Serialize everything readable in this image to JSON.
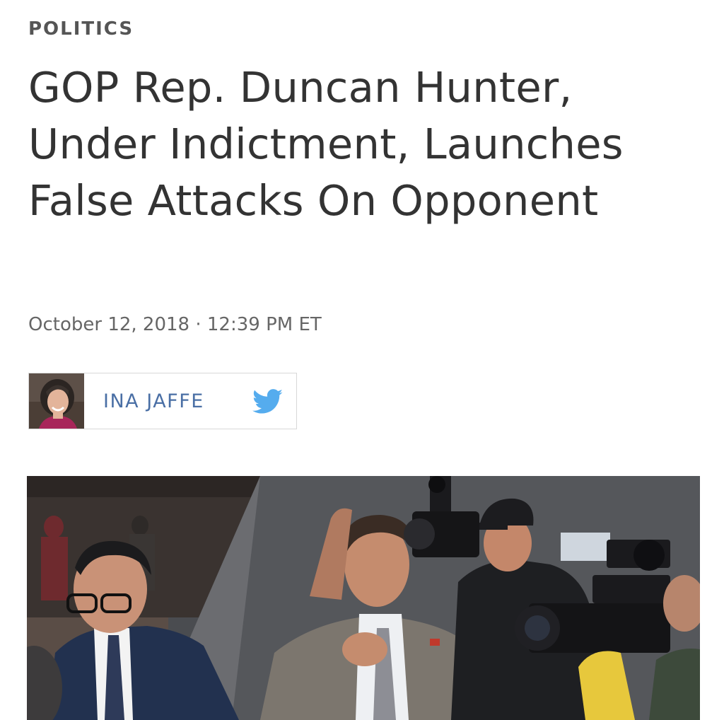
{
  "article": {
    "section": "POLITICS",
    "headline": "GOP Rep. Duncan Hunter, Under Indictment, Launches False Attacks On Opponent",
    "dateline": "October 12, 2018 · 12:39 PM ET"
  },
  "byline": {
    "author": "INA JAFFE",
    "social_icon": "twitter-icon",
    "accent_color": "#4a6fa5",
    "twitter_color": "#55acee"
  },
  "hero_image": {
    "subject": "photo-men-walking-with-camera-crews"
  }
}
